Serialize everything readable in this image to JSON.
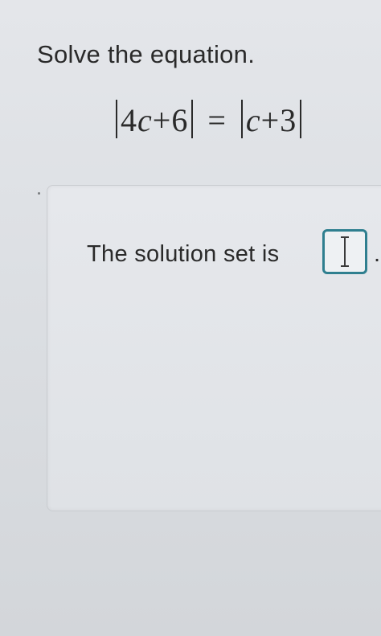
{
  "question": {
    "prompt": "Solve the equation.",
    "equation": {
      "left_coef": "4",
      "left_var": "c",
      "left_op": "+",
      "left_const": "6",
      "equals": "=",
      "right_var": "c",
      "right_op": "+",
      "right_const": "3"
    }
  },
  "answer": {
    "label": "The solution set is",
    "input_value": "",
    "trailing": "."
  },
  "colors": {
    "input_border": "#2f7f8f"
  },
  "icons": {
    "cursor": "text-cursor-icon"
  }
}
